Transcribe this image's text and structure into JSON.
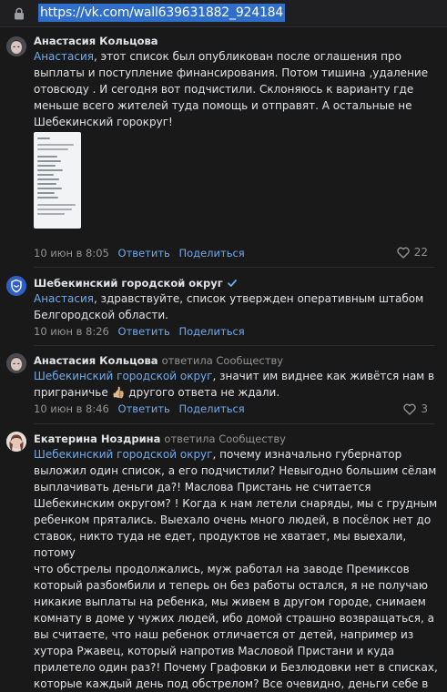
{
  "browser": {
    "url": "https://vk.com/wall639631882_924184"
  },
  "comments": [
    {
      "author": "Анастасия Кольцова",
      "reply_to": "",
      "mention": "Анастасия",
      "text": ", этот список был опубликован после оглашения про\nвыплаты и поступление финансирования. Потом тишина ,удаление\nотовсюду . И сегодня вот подчистили. Склоняюсь к варианту где\nменьше всего жителей туда помощь и отправят. А остальные не\nШебекинский горокруг!",
      "has_attachment": true,
      "date": "10 июн в 8:05",
      "reply_label": "Ответить",
      "share_label": "Поделиться",
      "likes": "22"
    },
    {
      "author": "Шебекинский городской округ",
      "reply_to": "",
      "mention": "Анастасия",
      "text": ", здравствуйте, список утвержден оперативным штабом\nБелгородской области.",
      "date": "10 июн в 8:26",
      "reply_label": "Ответить",
      "share_label": "Поделиться",
      "likes": ""
    },
    {
      "author": "Анастасия Кольцова",
      "reply_to": "ответила Сообществу",
      "mention": "Шебекинский городской округ",
      "text": ", значит им виднее как живётся нам в\nприграничье 👍🏼 другого ответа не ждали.",
      "date": "10 июн в 8:46",
      "reply_label": "Ответить",
      "share_label": "Поделиться",
      "likes": "3"
    },
    {
      "author": "Екатерина Ноздрина",
      "reply_to": "ответила Сообществу",
      "mention": "Шебекинский городской округ",
      "text": ", почему изначально губернатор\nвыложил один список, а его подчистили? Невыгодно большим сёлам\nвыплачивать деньги да?! Маслова Пристань не считается\nШебекинским округом? ! Когда к нам летели снаряды, мы с грудным\nребенком прятались. Выехало очень много людей, в посёлок нет до\nставок, никто туда не едет, продуктов не хватает, мы выехали, потому\nчто обстрелы продолжались, муж работал на заводе Премиксов\nкоторый разбомбили и теперь он без работы остался, я не получаю\nникакие выплаты на ребенка, мы живем в другом городе, снимаем\nкомнату в доме у чужих людей, ибо домой страшно возвращаться, а\nвы считаете, что наш ребенок отличается от детей, например из\nхутора Ржавец, который напротив Масловой Пристани и куда\nприлетело один раз?! Почему Графовки и Безлюдовки нет в списках,\nкоторые каждый день под обстрелом? Все очевидно, деньги себе в"
    }
  ],
  "colors": {
    "background": "#19191a",
    "link": "#71aaeb",
    "muted": "#939393",
    "url_highlight": "#2f6fc9"
  }
}
